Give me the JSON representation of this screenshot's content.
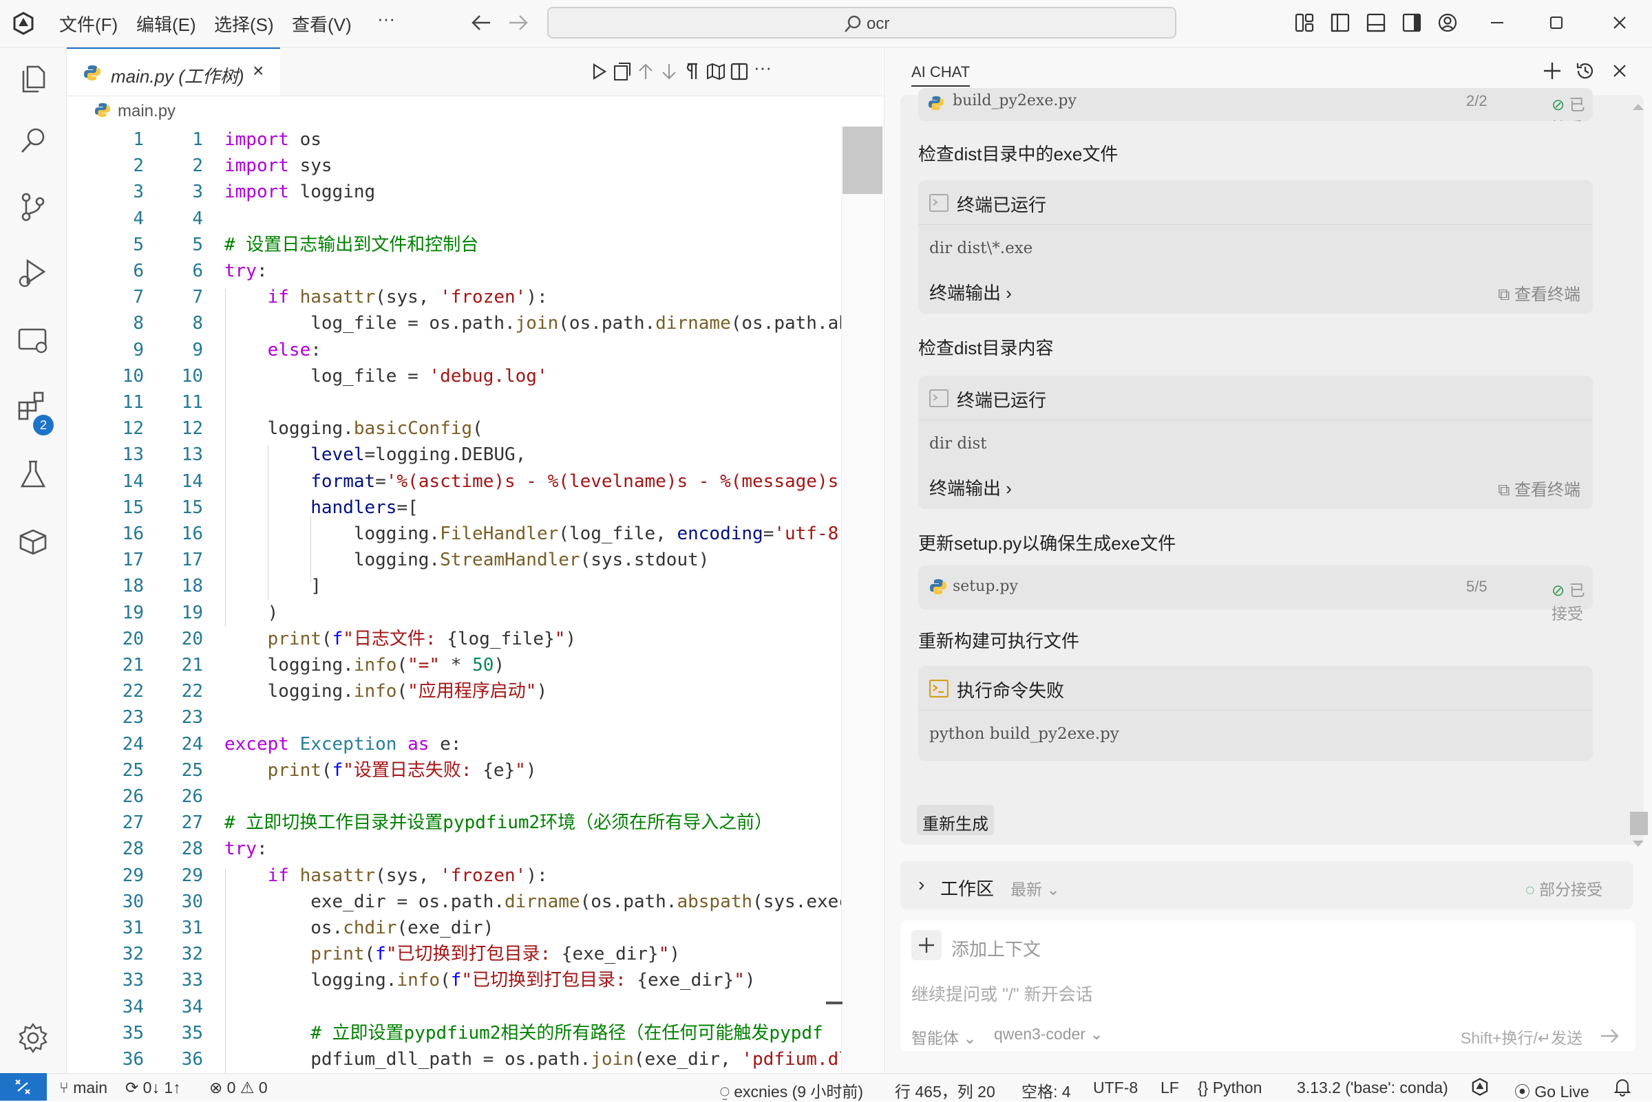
{
  "menu": [
    "文件(F)",
    "编辑(E)",
    "选择(S)",
    "查看(V)",
    "···"
  ],
  "search": {
    "value": "ocr"
  },
  "tab": {
    "label": "main.py (工作树)",
    "close": "×"
  },
  "breadcrumb": "main.py",
  "code_lines": [
    {
      "n": "1",
      "html": "<span class='kw'>import</span> os"
    },
    {
      "n": "2",
      "html": "<span class='kw'>import</span> sys"
    },
    {
      "n": "3",
      "html": "<span class='kw'>import</span> logging"
    },
    {
      "n": "4",
      "html": ""
    },
    {
      "n": "5",
      "html": "<span class='cm'># 设置日志输出到文件和控制台</span>"
    },
    {
      "n": "6",
      "html": "<span class='kw'>try</span>:"
    },
    {
      "n": "7",
      "html": "    <span class='kw'>if</span> <span class='fn'>hasattr</span>(sys, <span class='str'>'frozen'</span>):"
    },
    {
      "n": "8",
      "html": "        log_file = os.path.<span class='fn'>join</span>(os.path.<span class='fn'>dirname</span>(os.path.ab"
    },
    {
      "n": "9",
      "html": "    <span class='kw'>else</span>:"
    },
    {
      "n": "10",
      "html": "        log_file = <span class='str'>'debug.log'</span>"
    },
    {
      "n": "11",
      "html": ""
    },
    {
      "n": "12",
      "html": "    logging.<span class='fn'>basicConfig</span>("
    },
    {
      "n": "13",
      "html": "        <span class='pr'>level</span>=logging.DEBUG,"
    },
    {
      "n": "14",
      "html": "        <span class='pr'>format</span>=<span class='str'>'%(asctime)s - %(levelname)s - %(message)s'</span>"
    },
    {
      "n": "15",
      "html": "        <span class='pr'>handlers</span>=["
    },
    {
      "n": "16",
      "html": "            logging.<span class='fn'>FileHandler</span>(log_file, <span class='pr'>encoding</span>=<span class='str'>'utf-8'</span>"
    },
    {
      "n": "17",
      "html": "            logging.<span class='fn'>StreamHandler</span>(sys.stdout)"
    },
    {
      "n": "18",
      "html": "        ]"
    },
    {
      "n": "19",
      "html": "    )"
    },
    {
      "n": "20",
      "html": "    <span class='fn'>print</span>(<span class='kw2'>f</span><span class='str'>\"日志文件: </span>{log_file}<span class='str'>\"</span>)"
    },
    {
      "n": "21",
      "html": "    logging.<span class='fn'>info</span>(<span class='str'>\"=\"</span> * <span class='num'>50</span>)"
    },
    {
      "n": "22",
      "html": "    logging.<span class='fn'>info</span>(<span class='str'>\"应用程序启动\"</span>)"
    },
    {
      "n": "23",
      "html": ""
    },
    {
      "n": "24",
      "html": "<span class='kw'>except</span> <span class='ty'>Exception</span> <span class='kw'>as</span> e:"
    },
    {
      "n": "25",
      "html": "    <span class='fn'>print</span>(<span class='kw2'>f</span><span class='str'>\"设置日志失败: </span>{e}<span class='str'>\"</span>)"
    },
    {
      "n": "26",
      "html": ""
    },
    {
      "n": "27",
      "html": "<span class='cm'># 立即切换工作目录并设置pypdfium2环境（必须在所有导入之前）</span>"
    },
    {
      "n": "28",
      "html": "<span class='kw'>try</span>:"
    },
    {
      "n": "29",
      "html": "    <span class='kw'>if</span> <span class='fn'>hasattr</span>(sys, <span class='str'>'frozen'</span>):"
    },
    {
      "n": "30",
      "html": "        exe_dir = os.path.<span class='fn'>dirname</span>(os.path.<span class='fn'>abspath</span>(sys.execu"
    },
    {
      "n": "31",
      "html": "        os.<span class='fn'>chdir</span>(exe_dir)"
    },
    {
      "n": "32",
      "html": "        <span class='fn'>print</span>(<span class='kw2'>f</span><span class='str'>\"已切换到打包目录: </span>{exe_dir}<span class='str'>\"</span>)"
    },
    {
      "n": "33",
      "html": "        logging.<span class='fn'>info</span>(<span class='kw2'>f</span><span class='str'>\"已切换到打包目录: </span>{exe_dir}<span class='str'>\"</span>)"
    },
    {
      "n": "34",
      "html": ""
    },
    {
      "n": "35",
      "html": "        <span class='cm'># 立即设置pypdfium2相关的所有路径（在任何可能触发pypdf</span>"
    },
    {
      "n": "36",
      "html": "        pdfium_dll_path = os.path.<span class='fn'>join</span>(exe_dir, <span class='str'>'pdfium.dl</span>"
    }
  ],
  "ai": {
    "title": "AI CHAT",
    "top_file": {
      "name": "build_py2exe.py",
      "count": "2/2",
      "status": "已接受"
    },
    "steps": [
      {
        "title": "检查dist目录中的exe文件",
        "header": "终端已运行",
        "cmd": "dir dist\\*.exe",
        "output": "终端输出",
        "view": "查看终端"
      },
      {
        "title": "检查dist目录内容",
        "header": "终端已运行",
        "cmd": "dir dist",
        "output": "终端输出",
        "view": "查看终端"
      }
    ],
    "update_title": "更新setup.py以确保生成exe文件",
    "update_file": {
      "name": "setup.py",
      "count": "5/5",
      "status": "已接受"
    },
    "rebuild_title": "重新构建可执行文件",
    "fail_header": "执行命令失败",
    "fail_cmd": "python build_py2exe.py",
    "regen": "重新生成",
    "workspace": {
      "label": "工作区",
      "sort": "最新",
      "status": "部分接受"
    },
    "input": {
      "add_context": "添加上下文",
      "placeholder": "继续提问或 \"/\" 新开会话",
      "agent": "智能体",
      "model": "qwen3-coder",
      "send_hint": "Shift+换行/↵发送"
    }
  },
  "status": {
    "branch": "main",
    "sync": "0↓ 1↑",
    "errors": "0",
    "warnings": "0",
    "git_info": "excnies (9 小时前)",
    "position": "行 465，列 20",
    "indent": "空格: 4",
    "encoding": "UTF-8",
    "eol": "LF",
    "language": "Python",
    "interpreter": "3.13.2 ('base': conda)",
    "golive": "Go Live"
  },
  "activity_badge": "2",
  "colors": {
    "accent": "#1e72c7",
    "keyword": "#af00db",
    "string": "#a31515",
    "comment": "#008000",
    "function": "#795e26"
  }
}
